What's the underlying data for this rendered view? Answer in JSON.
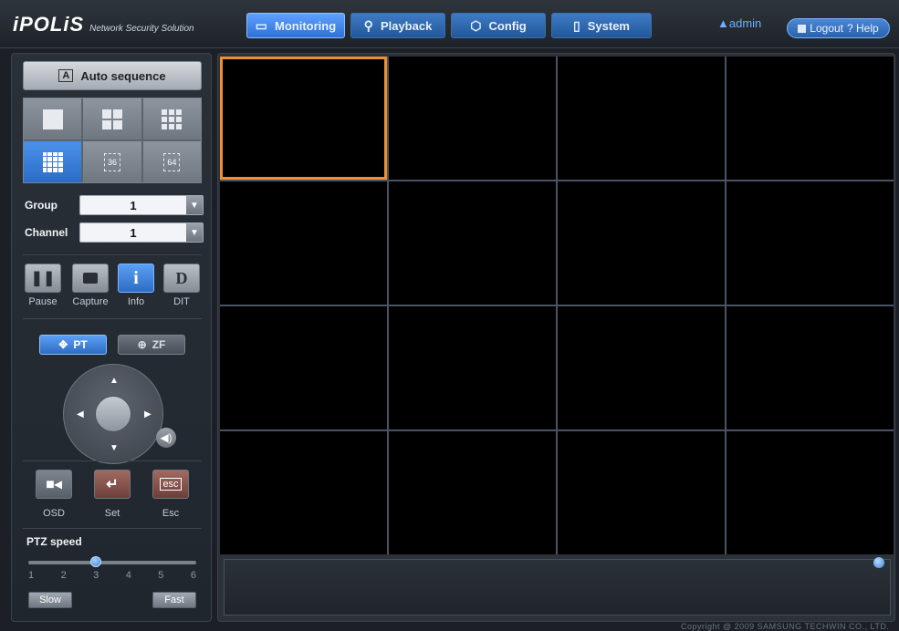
{
  "app": {
    "logo": "iPOLiS",
    "logo_sub": "Network Security Solution"
  },
  "nav": {
    "monitoring": "Monitoring",
    "playback": "Playback",
    "config": "Config",
    "system": "System"
  },
  "user": {
    "name": "admin",
    "logout": "Logout",
    "help": "? Help"
  },
  "left": {
    "auto_sequence": "Auto sequence",
    "layout_36": "36",
    "layout_64": "64",
    "group_label": "Group",
    "group_value": "1",
    "channel_label": "Channel",
    "channel_value": "1",
    "pause": "Pause",
    "capture": "Capture",
    "info": "Info",
    "dit": "DIT",
    "info_glyph": "i",
    "dit_glyph": "D",
    "pt": "PT",
    "zf": "ZF",
    "osd": "OSD",
    "set": "Set",
    "esc": "Esc",
    "esc_glyph": "esc",
    "ptz_speed": "PTZ speed",
    "speed_values": [
      "1",
      "2",
      "3",
      "4",
      "5",
      "6"
    ],
    "speed_selected": 3,
    "slow": "Slow",
    "fast": "Fast"
  },
  "main": {
    "grid_cells": 16,
    "selected_cell": 1
  },
  "footer": {
    "copyright": "Copyright @ 2009 SAMSUNG TECHWIN CO., LTD."
  },
  "colors": {
    "accent": "#2d71d6",
    "selected_cell_border": "#ef8f2f"
  }
}
